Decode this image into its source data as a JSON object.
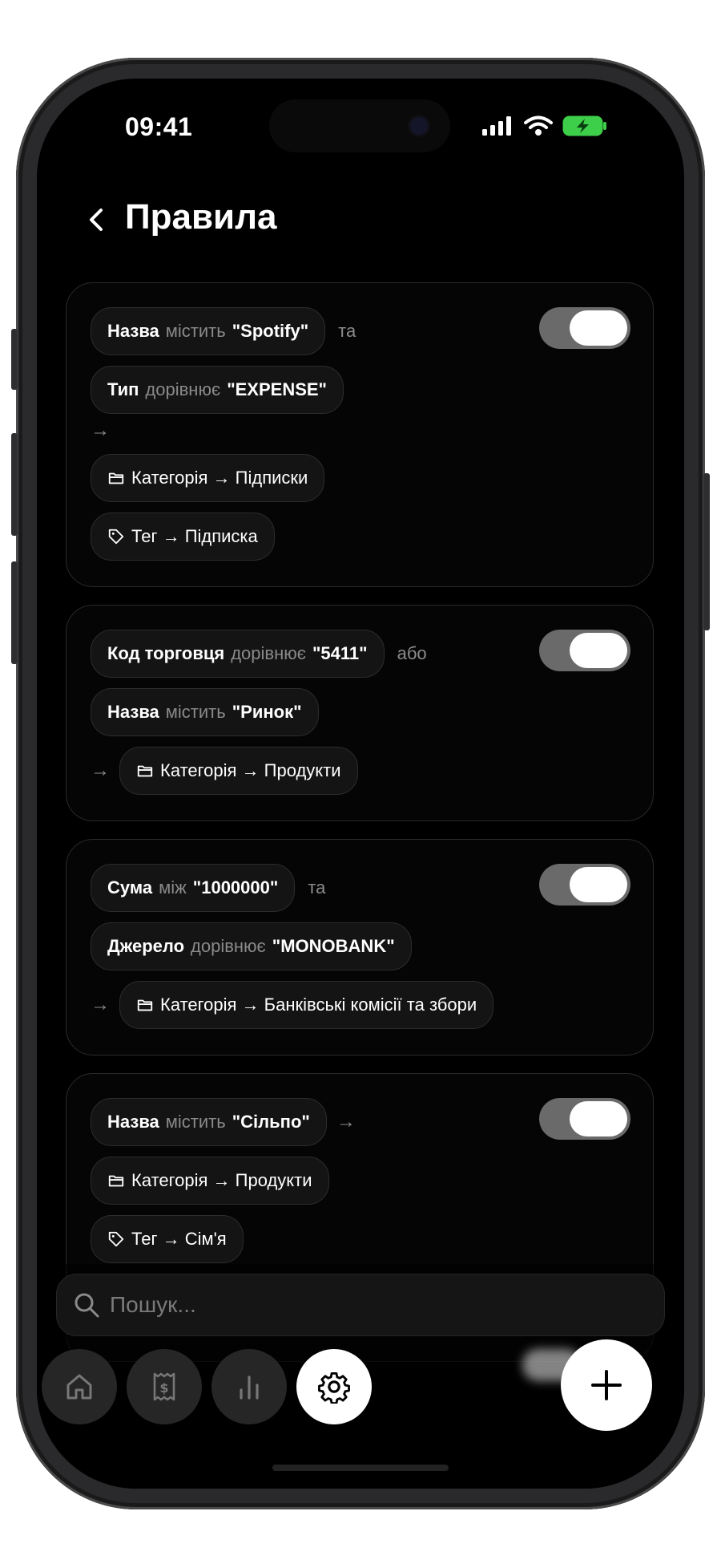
{
  "status_bar": {
    "time": "09:41"
  },
  "header": {
    "title": "Правила"
  },
  "rules": [
    {
      "enabled": true,
      "conditions": [
        {
          "field": "Назва",
          "op": "містить",
          "value": "\"Spotify\"",
          "joiner": "та"
        },
        {
          "field": "Тип",
          "op": "дорівнює",
          "value": "\"EXPENSE\"",
          "joiner": ""
        }
      ],
      "arrow": "→",
      "actions": [
        {
          "icon": "folder-icon",
          "text": "Категорія → Підписки"
        },
        {
          "icon": "tag-icon",
          "text": "Тег → Підписка"
        }
      ]
    },
    {
      "enabled": true,
      "conditions": [
        {
          "field": "Код торговця",
          "op": "дорівнює",
          "value": "\"5411\"",
          "joiner": "або"
        },
        {
          "field": "Назва",
          "op": "містить",
          "value": "\"Ринок\"",
          "joiner": ""
        }
      ],
      "arrow": "→",
      "actions": [
        {
          "icon": "folder-icon",
          "text": "Категорія → Продукти"
        }
      ]
    },
    {
      "enabled": true,
      "conditions": [
        {
          "field": "Сума",
          "op": "між",
          "value": "\"1000000\"",
          "joiner": "та"
        },
        {
          "field": "Джерело",
          "op": "дорівнює",
          "value": "\"MONOBANK\"",
          "joiner": ""
        }
      ],
      "arrow": "→",
      "actions": [
        {
          "icon": "folder-icon",
          "text": "Категорія → Банківські комісії та збори"
        }
      ]
    },
    {
      "enabled": true,
      "conditions": [
        {
          "field": "Назва",
          "op": "містить",
          "value": "\"Сільпо\"",
          "joiner": ""
        }
      ],
      "arrow": "→",
      "actions": [
        {
          "icon": "folder-icon",
          "text": "Категорія → Продукти"
        },
        {
          "icon": "tag-icon",
          "text": "Тег → Сім'я"
        }
      ]
    }
  ],
  "search": {
    "placeholder": "Пошук..."
  },
  "tabbar": {
    "tabs": [
      {
        "icon": "home-icon",
        "active": false
      },
      {
        "icon": "receipt-icon",
        "active": false
      },
      {
        "icon": "chart-icon",
        "active": false
      },
      {
        "icon": "gear-icon",
        "active": true
      }
    ],
    "fab_icon": "plus-icon"
  },
  "colors": {
    "background": "#000000",
    "chip": "#141414",
    "toggle_track": "#6a6a6a",
    "accent": "#ffffff"
  }
}
